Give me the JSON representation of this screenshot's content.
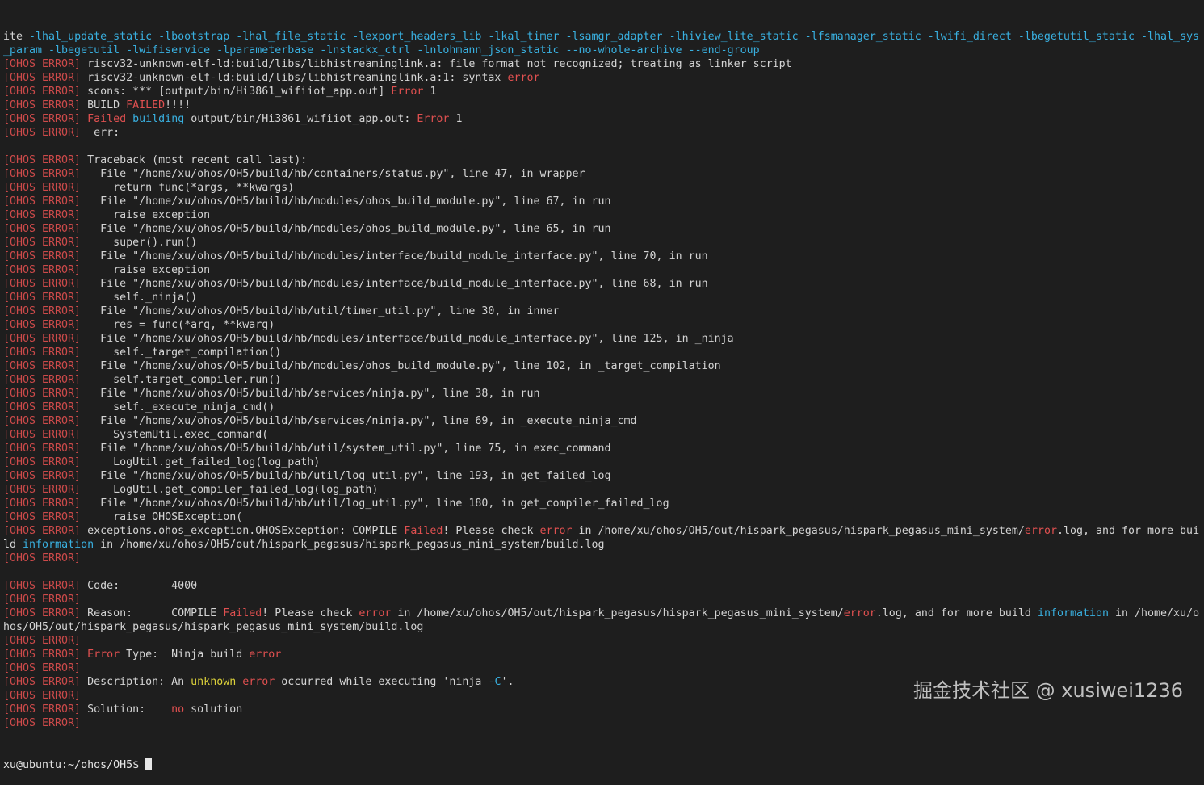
{
  "window": {
    "prompt": "xu@ubuntu:~/ohos/OH5$ "
  },
  "watermark": {
    "text": "掘金技术社区 @ xusiwei1236"
  },
  "colors": {
    "background": "#1e1e1e",
    "tag_red": "#cd4a4a",
    "error_red": "#e05050",
    "flag_cyan": "#39b0e0",
    "warn_yellow": "#dcd13a",
    "text": "#d4d4d4"
  },
  "lines": [
    [
      {
        "t": "ite ",
        "c": "txt"
      },
      {
        "t": "-lhal_update_static -lbootstrap -lhal_file_static -lexport_headers_lib -lkal_timer -lsamgr_adapter -lhiview_lite_static -lfsmanager_static -lwifi_direct -lbegetutil_static -lhal_sys",
        "c": "flag"
      }
    ],
    [
      {
        "t": "_param -lbegetutil -lwifiservice -lparameterbase -lnstackx_ctrl -lnlohmann_json_static --no-whole-archive --end-group",
        "c": "flag"
      }
    ],
    [
      {
        "t": "[OHOS ERROR]",
        "c": "tag"
      },
      {
        "t": " riscv32-unknown-elf-ld:build/libs/libhistreaminglink.a: file format not recognized; treating as linker script",
        "c": "txt"
      }
    ],
    [
      {
        "t": "[OHOS ERROR]",
        "c": "tag"
      },
      {
        "t": " riscv32-unknown-elf-ld:build/libs/libhistreaminglink.a:1: syntax ",
        "c": "txt"
      },
      {
        "t": "error",
        "c": "err"
      }
    ],
    [
      {
        "t": "[OHOS ERROR]",
        "c": "tag"
      },
      {
        "t": " scons: *** [output/bin/Hi3861_wifiiot_app.out] ",
        "c": "txt"
      },
      {
        "t": "Error",
        "c": "err"
      },
      {
        "t": " 1",
        "c": "txt"
      }
    ],
    [
      {
        "t": "[OHOS ERROR]",
        "c": "tag"
      },
      {
        "t": " BUILD ",
        "c": "txt"
      },
      {
        "t": "FAILED",
        "c": "err"
      },
      {
        "t": "!!!!",
        "c": "txt"
      }
    ],
    [
      {
        "t": "[OHOS ERROR]",
        "c": "tag"
      },
      {
        "t": " ",
        "c": "txt"
      },
      {
        "t": "Failed",
        "c": "err"
      },
      {
        "t": " ",
        "c": "txt"
      },
      {
        "t": "building",
        "c": "flag"
      },
      {
        "t": " output/bin/Hi3861_wifiiot_app.out: ",
        "c": "txt"
      },
      {
        "t": "Error",
        "c": "err"
      },
      {
        "t": " 1",
        "c": "txt"
      }
    ],
    [
      {
        "t": "[OHOS ERROR]",
        "c": "tag"
      },
      {
        "t": "  err:",
        "c": "txt"
      }
    ],
    [],
    [
      {
        "t": "[OHOS ERROR]",
        "c": "tag"
      },
      {
        "t": " Traceback (most recent call last):",
        "c": "txt"
      }
    ],
    [
      {
        "t": "[OHOS ERROR]",
        "c": "tag"
      },
      {
        "t": "   File \"/home/xu/ohos/OH5/build/hb/containers/status.py\", line 47, in wrapper",
        "c": "txt"
      }
    ],
    [
      {
        "t": "[OHOS ERROR]",
        "c": "tag"
      },
      {
        "t": "     return func(*args, **kwargs)",
        "c": "txt"
      }
    ],
    [
      {
        "t": "[OHOS ERROR]",
        "c": "tag"
      },
      {
        "t": "   File \"/home/xu/ohos/OH5/build/hb/modules/ohos_build_module.py\", line 67, in run",
        "c": "txt"
      }
    ],
    [
      {
        "t": "[OHOS ERROR]",
        "c": "tag"
      },
      {
        "t": "     raise exception",
        "c": "txt"
      }
    ],
    [
      {
        "t": "[OHOS ERROR]",
        "c": "tag"
      },
      {
        "t": "   File \"/home/xu/ohos/OH5/build/hb/modules/ohos_build_module.py\", line 65, in run",
        "c": "txt"
      }
    ],
    [
      {
        "t": "[OHOS ERROR]",
        "c": "tag"
      },
      {
        "t": "     super().run()",
        "c": "txt"
      }
    ],
    [
      {
        "t": "[OHOS ERROR]",
        "c": "tag"
      },
      {
        "t": "   File \"/home/xu/ohos/OH5/build/hb/modules/interface/build_module_interface.py\", line 70, in run",
        "c": "txt"
      }
    ],
    [
      {
        "t": "[OHOS ERROR]",
        "c": "tag"
      },
      {
        "t": "     raise exception",
        "c": "txt"
      }
    ],
    [
      {
        "t": "[OHOS ERROR]",
        "c": "tag"
      },
      {
        "t": "   File \"/home/xu/ohos/OH5/build/hb/modules/interface/build_module_interface.py\", line 68, in run",
        "c": "txt"
      }
    ],
    [
      {
        "t": "[OHOS ERROR]",
        "c": "tag"
      },
      {
        "t": "     self._ninja()",
        "c": "txt"
      }
    ],
    [
      {
        "t": "[OHOS ERROR]",
        "c": "tag"
      },
      {
        "t": "   File \"/home/xu/ohos/OH5/build/hb/util/timer_util.py\", line 30, in inner",
        "c": "txt"
      }
    ],
    [
      {
        "t": "[OHOS ERROR]",
        "c": "tag"
      },
      {
        "t": "     res = func(*arg, **kwarg)",
        "c": "txt"
      }
    ],
    [
      {
        "t": "[OHOS ERROR]",
        "c": "tag"
      },
      {
        "t": "   File \"/home/xu/ohos/OH5/build/hb/modules/interface/build_module_interface.py\", line 125, in _ninja",
        "c": "txt"
      }
    ],
    [
      {
        "t": "[OHOS ERROR]",
        "c": "tag"
      },
      {
        "t": "     self._target_compilation()",
        "c": "txt"
      }
    ],
    [
      {
        "t": "[OHOS ERROR]",
        "c": "tag"
      },
      {
        "t": "   File \"/home/xu/ohos/OH5/build/hb/modules/ohos_build_module.py\", line 102, in _target_compilation",
        "c": "txt"
      }
    ],
    [
      {
        "t": "[OHOS ERROR]",
        "c": "tag"
      },
      {
        "t": "     self.target_compiler.run()",
        "c": "txt"
      }
    ],
    [
      {
        "t": "[OHOS ERROR]",
        "c": "tag"
      },
      {
        "t": "   File \"/home/xu/ohos/OH5/build/hb/services/ninja.py\", line 38, in run",
        "c": "txt"
      }
    ],
    [
      {
        "t": "[OHOS ERROR]",
        "c": "tag"
      },
      {
        "t": "     self._execute_ninja_cmd()",
        "c": "txt"
      }
    ],
    [
      {
        "t": "[OHOS ERROR]",
        "c": "tag"
      },
      {
        "t": "   File \"/home/xu/ohos/OH5/build/hb/services/ninja.py\", line 69, in _execute_ninja_cmd",
        "c": "txt"
      }
    ],
    [
      {
        "t": "[OHOS ERROR]",
        "c": "tag"
      },
      {
        "t": "     SystemUtil.exec_command(",
        "c": "txt"
      }
    ],
    [
      {
        "t": "[OHOS ERROR]",
        "c": "tag"
      },
      {
        "t": "   File \"/home/xu/ohos/OH5/build/hb/util/system_util.py\", line 75, in exec_command",
        "c": "txt"
      }
    ],
    [
      {
        "t": "[OHOS ERROR]",
        "c": "tag"
      },
      {
        "t": "     LogUtil.get_failed_log(log_path)",
        "c": "txt"
      }
    ],
    [
      {
        "t": "[OHOS ERROR]",
        "c": "tag"
      },
      {
        "t": "   File \"/home/xu/ohos/OH5/build/hb/util/log_util.py\", line 193, in get_failed_log",
        "c": "txt"
      }
    ],
    [
      {
        "t": "[OHOS ERROR]",
        "c": "tag"
      },
      {
        "t": "     LogUtil.get_compiler_failed_log(log_path)",
        "c": "txt"
      }
    ],
    [
      {
        "t": "[OHOS ERROR]",
        "c": "tag"
      },
      {
        "t": "   File \"/home/xu/ohos/OH5/build/hb/util/log_util.py\", line 180, in get_compiler_failed_log",
        "c": "txt"
      }
    ],
    [
      {
        "t": "[OHOS ERROR]",
        "c": "tag"
      },
      {
        "t": "     raise OHOSException(",
        "c": "txt"
      }
    ],
    [
      {
        "t": "[OHOS ERROR]",
        "c": "tag"
      },
      {
        "t": " exceptions.ohos_exception.OHOSException: COMPILE ",
        "c": "txt"
      },
      {
        "t": "Failed",
        "c": "err"
      },
      {
        "t": "! Please check ",
        "c": "txt"
      },
      {
        "t": "error",
        "c": "err"
      },
      {
        "t": " in /home/xu/ohos/OH5/out/hispark_pegasus/hispark_pegasus_mini_system/",
        "c": "txt"
      },
      {
        "t": "error",
        "c": "err"
      },
      {
        "t": ".log, and for more bui",
        "c": "txt"
      }
    ],
    [
      {
        "t": "ld ",
        "c": "txt"
      },
      {
        "t": "information",
        "c": "flag"
      },
      {
        "t": " in /home/xu/ohos/OH5/out/hispark_pegasus/hispark_pegasus_mini_system/build.log",
        "c": "txt"
      }
    ],
    [
      {
        "t": "[OHOS ERROR]",
        "c": "tag"
      }
    ],
    [],
    [
      {
        "t": "[OHOS ERROR]",
        "c": "tag"
      },
      {
        "t": " Code:        4000",
        "c": "txt"
      }
    ],
    [
      {
        "t": "[OHOS ERROR]",
        "c": "tag"
      }
    ],
    [
      {
        "t": "[OHOS ERROR]",
        "c": "tag"
      },
      {
        "t": " Reason:      COMPILE ",
        "c": "txt"
      },
      {
        "t": "Failed",
        "c": "err"
      },
      {
        "t": "! Please check ",
        "c": "txt"
      },
      {
        "t": "error",
        "c": "err"
      },
      {
        "t": " in /home/xu/ohos/OH5/out/hispark_pegasus/hispark_pegasus_mini_system/",
        "c": "txt"
      },
      {
        "t": "error",
        "c": "err"
      },
      {
        "t": ".log, and for more build ",
        "c": "txt"
      },
      {
        "t": "information",
        "c": "flag"
      },
      {
        "t": " in /home/xu/o",
        "c": "txt"
      }
    ],
    [
      {
        "t": "hos/OH5/out/hispark_pegasus/hispark_pegasus_mini_system/build.log",
        "c": "txt"
      }
    ],
    [
      {
        "t": "[OHOS ERROR]",
        "c": "tag"
      }
    ],
    [
      {
        "t": "[OHOS ERROR]",
        "c": "tag"
      },
      {
        "t": " ",
        "c": "txt"
      },
      {
        "t": "Error",
        "c": "err"
      },
      {
        "t": " Type:  Ninja build ",
        "c": "txt"
      },
      {
        "t": "error",
        "c": "err"
      }
    ],
    [
      {
        "t": "[OHOS ERROR]",
        "c": "tag"
      }
    ],
    [
      {
        "t": "[OHOS ERROR]",
        "c": "tag"
      },
      {
        "t": " Description: An ",
        "c": "txt"
      },
      {
        "t": "unknown",
        "c": "warn"
      },
      {
        "t": " ",
        "c": "txt"
      },
      {
        "t": "error",
        "c": "err"
      },
      {
        "t": " occurred while executing 'ninja ",
        "c": "txt"
      },
      {
        "t": "-C",
        "c": "flag"
      },
      {
        "t": "'.",
        "c": "txt"
      }
    ],
    [
      {
        "t": "[OHOS ERROR]",
        "c": "tag"
      }
    ],
    [
      {
        "t": "[OHOS ERROR]",
        "c": "tag"
      },
      {
        "t": " Solution:    ",
        "c": "txt"
      },
      {
        "t": "no",
        "c": "err"
      },
      {
        "t": " solution",
        "c": "txt"
      }
    ],
    [
      {
        "t": "[OHOS ERROR]",
        "c": "tag"
      }
    ]
  ]
}
